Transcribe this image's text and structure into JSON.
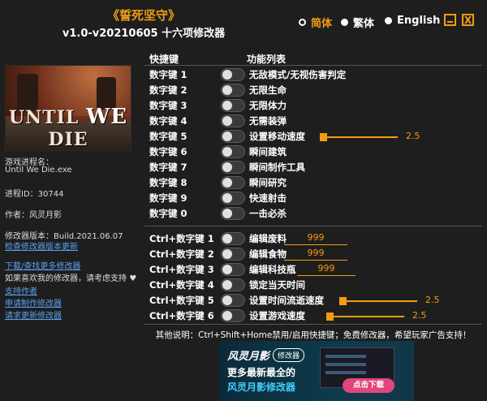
{
  "header": {
    "title": "《誓死坚守》",
    "subtitle": "v1.0-v20210605 十六项修改器",
    "languages": [
      {
        "label": "简体",
        "selected": true
      },
      {
        "label": "繁体",
        "selected": false
      },
      {
        "label": "English",
        "selected": false
      }
    ],
    "close_label": "X"
  },
  "left": {
    "banner": {
      "word1": "UNTIL",
      "word2": "WE",
      "word3": "DIE"
    },
    "process_label": "游戏进程名：",
    "process_value": "Until We Die.exe",
    "pid_label": "进程ID：30744",
    "author_label": "作者：风灵月影",
    "version_label": "修改器版本：Build.2021.06.07",
    "check_label": "检查修改器版本更新",
    "links": [
      "下载/查找更多修改器",
      "如果喜欢我的修改器，请考虑支持",
      "支持作者",
      "申请制作修改器",
      "请求更新修改器"
    ]
  },
  "columns": {
    "hotkey": "快捷键",
    "function": "功能列表"
  },
  "rows": [
    {
      "key": "数字键 1",
      "fn": "无敌模式/无视伤害判定"
    },
    {
      "key": "数字键 2",
      "fn": "无限生命"
    },
    {
      "key": "数字键 3",
      "fn": "无限体力"
    },
    {
      "key": "数字键 4",
      "fn": "无需装弹"
    },
    {
      "key": "数字键 5",
      "fn": "设置移动速度",
      "value": "2.5",
      "slider": 0.5
    },
    {
      "key": "数字键 6",
      "fn": "瞬间建筑"
    },
    {
      "key": "数字键 7",
      "fn": "瞬间制作工具"
    },
    {
      "key": "数字键 8",
      "fn": "瞬间研究"
    },
    {
      "key": "数字键 9",
      "fn": "快速射击"
    },
    {
      "key": "数字键 0",
      "fn": "一击必杀"
    },
    {
      "key": "Ctrl+数字键 1",
      "fn": "编辑废料",
      "edit": "999"
    },
    {
      "key": "Ctrl+数字键 2",
      "fn": "编辑食物",
      "edit": "999"
    },
    {
      "key": "Ctrl+数字键 3",
      "fn": "编辑科技瓶",
      "edit": "999"
    },
    {
      "key": "Ctrl+数字键 4",
      "fn": "锁定当天时间"
    },
    {
      "key": "Ctrl+数字键 5",
      "fn": "设置时间流逝速度",
      "value": "2.5",
      "slider": 0.5
    },
    {
      "key": "Ctrl+数字键 6",
      "fn": "设置游戏速度",
      "value": "2.5",
      "slider": 0.5
    }
  ],
  "footer_note": "其他说明：Ctrl+Shift+Home禁用/启用快捷键；免费修改器，希望玩家广告支持！",
  "ad": {
    "brand": "风灵月影",
    "tag": "修改器",
    "line1": "更多最新最全的",
    "line2": "风灵月影修改器",
    "download": "点击下载"
  },
  "colors": {
    "accent": "#f39c12",
    "background": "#1e1e1e",
    "link": "#5aa0f0"
  }
}
